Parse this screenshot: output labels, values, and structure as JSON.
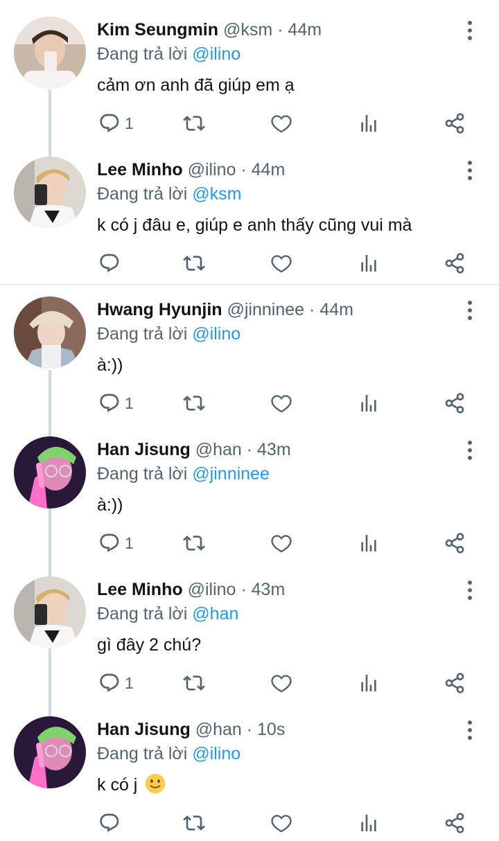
{
  "colors": {
    "accent": "#1d9bf0",
    "secondary_text": "#536471",
    "primary_text": "#0f1419"
  },
  "tweets": [
    {
      "name": "Kim Seungmin",
      "handle": "@ksm",
      "sep": "·",
      "time": "44m",
      "replying_label": "Đang trả lời",
      "replying_to": "@ilino",
      "text": "cảm ơn anh đã giúp em ạ",
      "reply_count": "1",
      "avatar": "avatar-photo"
    },
    {
      "name": "Lee Minho",
      "handle": "@ilino",
      "sep": "·",
      "time": "44m",
      "replying_label": "Đang trả lời",
      "replying_to": "@ksm",
      "text": "k có j đâu e, giúp e anh thấy cũng vui mà",
      "reply_count": "",
      "avatar": "avatar-photo"
    },
    {
      "name": "Hwang Hyunjin",
      "handle": "@jinninee",
      "sep": "·",
      "time": "44m",
      "replying_label": "Đang trả lời",
      "replying_to": "@ilino",
      "text": "à:))",
      "reply_count": "1",
      "avatar": "avatar-photo"
    },
    {
      "name": "Han Jisung",
      "handle": "@han",
      "sep": "·",
      "time": "43m",
      "replying_label": "Đang trả lời",
      "replying_to": "@jinninee",
      "text": "à:))",
      "reply_count": "1",
      "avatar": "avatar-photo"
    },
    {
      "name": "Lee Minho",
      "handle": "@ilino",
      "sep": "·",
      "time": "43m",
      "replying_label": "Đang trả lời",
      "replying_to": "@han",
      "text": "gì đây 2 chú?",
      "reply_count": "1",
      "avatar": "avatar-photo"
    },
    {
      "name": "Han Jisung",
      "handle": "@han",
      "sep": "·",
      "time": "10s",
      "replying_label": "Đang trả lời",
      "replying_to": "@ilino",
      "text": "k có j",
      "emoji": "slightly-smiling-face",
      "reply_count": "",
      "avatar": "avatar-photo"
    }
  ],
  "icons": {
    "reply": "reply-icon",
    "retweet": "retweet-icon",
    "like": "heart-icon",
    "stats": "analytics-icon",
    "share": "share-icon",
    "more": "more-vertical-icon"
  }
}
